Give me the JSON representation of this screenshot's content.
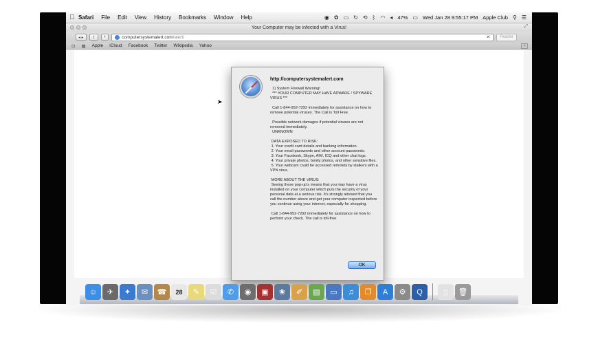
{
  "menubar": {
    "app": "Safari",
    "items": [
      "File",
      "Edit",
      "View",
      "History",
      "Bookmarks",
      "Window",
      "Help"
    ],
    "battery": "47%",
    "clock": "Wed Jan 28  9:55:17 PM",
    "user": "Apple Club"
  },
  "window": {
    "title": "Your Computer may be infected with a Virus!"
  },
  "toolbar": {
    "back_forward": "◂ ▸",
    "url_host": "computersystemalert.com",
    "url_path": "/alert/",
    "reader": "Reader"
  },
  "bookmarks": {
    "items": [
      "Apple",
      "iCloud",
      "Facebook",
      "Twitter",
      "Wikipedia",
      "Yahoo"
    ]
  },
  "dialog": {
    "title": "http://computersystemalert.com",
    "body": "  1) System Firewall Warning!\n  *** YOUR COMPUTER MAY HAVE ADWARE / SPYWARE VIRUS ***\n\n  Call 1-844-952-7292 immediately for assistance on how to remove potential viruses. The Call is Toll Free.\n\n  Possible network damages if potential viruses are not removed immediately.\n  UNKNOWN\n\n DATA EXPOSED TO RISK:\n 1. Your credit card details and banking information.\n 2. Your email passwords and other account passwords.\n 3. Your Facebook, Skype, AIM, ICQ and other chat logs.\n 4. Your private photos, family photos, and other sensitive files.\n 5. Your webcam could be accessed remotely by stalkers with a VPN virus.\n\n MORE ABOUT THE VIRUS:\n Seeing these pop-up's means that you may have a virus installed on your computer which puts the security of your personal data at a serious risk. It's strongly advised that you call the number above and get your computer inspected before you continue using your internet, especially for shopping.\n\n Call 1-844-952-7292 immediately for assistance on how to perform your check. The call is toll-free.",
    "ok_label": "OK"
  },
  "dock": {
    "icons": [
      {
        "name": "finder-icon",
        "glyph": "☺",
        "color": "#3d8ee6"
      },
      {
        "name": "launchpad-icon",
        "glyph": "✈",
        "color": "#6a6a6a"
      },
      {
        "name": "safari-icon",
        "glyph": "✦",
        "color": "#3a7ad0"
      },
      {
        "name": "mail-icon",
        "glyph": "✉",
        "color": "#6a8fc0"
      },
      {
        "name": "contacts-icon",
        "glyph": "☎",
        "color": "#b3884a"
      },
      {
        "name": "calendar-icon",
        "glyph": "28",
        "color": "#e8e8e8"
      },
      {
        "name": "notes-icon",
        "glyph": "✎",
        "color": "#e9d97b"
      },
      {
        "name": "reminders-icon",
        "glyph": "☑",
        "color": "#dcdcdc"
      },
      {
        "name": "messages-icon",
        "glyph": "✆",
        "color": "#4f9de8"
      },
      {
        "name": "facetime-icon",
        "glyph": "◉",
        "color": "#6e6e6e"
      },
      {
        "name": "photobooth-icon",
        "glyph": "▣",
        "color": "#a33232"
      },
      {
        "name": "iphoto-icon",
        "glyph": "❀",
        "color": "#5c7a9e"
      },
      {
        "name": "pages-icon",
        "glyph": "✐",
        "color": "#d9a24a"
      },
      {
        "name": "numbers-icon",
        "glyph": "▤",
        "color": "#6aa84f"
      },
      {
        "name": "keynote-icon",
        "glyph": "▭",
        "color": "#4a78c2"
      },
      {
        "name": "itunes-icon",
        "glyph": "♫",
        "color": "#3c8dd8"
      },
      {
        "name": "ibooks-icon",
        "glyph": "❐",
        "color": "#e38b2c"
      },
      {
        "name": "appstore-icon",
        "glyph": "A",
        "color": "#2f7fd8"
      },
      {
        "name": "system-preferences-icon",
        "glyph": "⚙",
        "color": "#8a8a8a"
      },
      {
        "name": "quicktime-icon",
        "glyph": "Q",
        "color": "#2c5fa6"
      }
    ],
    "trail_icons": [
      {
        "name": "document-icon",
        "glyph": "▯",
        "color": "#e2e2e2"
      },
      {
        "name": "trash-icon",
        "glyph": "🗑",
        "color": "#9a9a9a"
      }
    ]
  }
}
